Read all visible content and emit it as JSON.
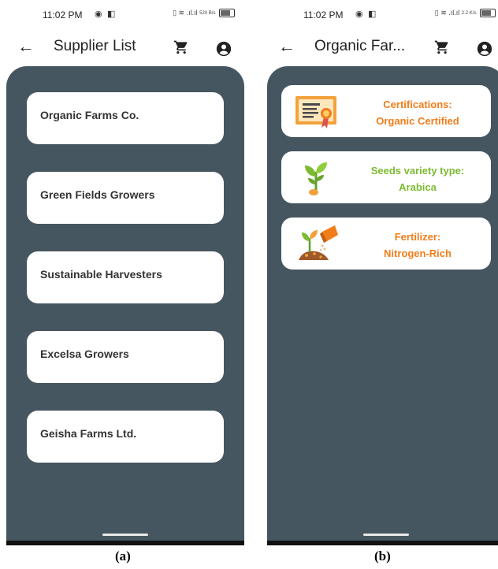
{
  "status_bar": {
    "time": "11:02 PM",
    "speed_a": "520 B/s",
    "speed_b": "2.2 K/s"
  },
  "screen_a": {
    "title": "Supplier List",
    "suppliers": [
      "Organic Farms Co.",
      "Green Fields Growers",
      "Sustainable Harvesters",
      "Excelsa Growers",
      "Geisha Farms Ltd."
    ],
    "caption": "(a)"
  },
  "screen_b": {
    "title": "Organic Far...",
    "attributes": [
      {
        "icon": "certificate-icon",
        "label": "Certifications:",
        "value": "Organic Certified",
        "color": "#f07d1a"
      },
      {
        "icon": "seedling-icon",
        "label": "Seeds variety type:",
        "value": "Arabica",
        "color": "#7dbb32"
      },
      {
        "icon": "fertilizer-icon",
        "label": "Fertilizer:",
        "value": "Nitrogen-Rich",
        "color": "#f07d1a"
      }
    ],
    "caption": "(b)"
  },
  "colors": {
    "panel": "#465660",
    "card": "#ffffff",
    "orange_text": "#f07d1a",
    "green_text": "#7dbb32"
  }
}
